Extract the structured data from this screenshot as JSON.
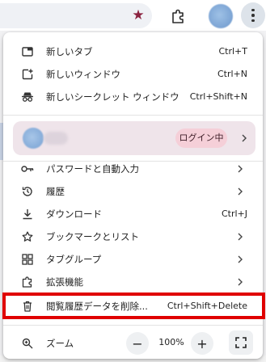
{
  "menu": {
    "items": [
      {
        "icon": "new-tab-icon",
        "label": "新しいタブ",
        "shortcut": "Ctrl+T"
      },
      {
        "icon": "new-window-icon",
        "label": "新しいウィンドウ",
        "shortcut": "Ctrl+N"
      },
      {
        "icon": "incognito-icon",
        "label": "新しいシークレット ウィンドウ",
        "shortcut": "Ctrl+Shift+N"
      }
    ],
    "profile": {
      "status": "ログイン中"
    },
    "items2": [
      {
        "icon": "key-icon",
        "label": "パスワードと自動入力"
      },
      {
        "icon": "history-icon",
        "label": "履歴"
      },
      {
        "icon": "download-icon",
        "label": "ダウンロード",
        "shortcut": "Ctrl+J"
      },
      {
        "icon": "bookmark-star-icon",
        "label": "ブックマークとリスト"
      },
      {
        "icon": "tab-groups-icon",
        "label": "タブグループ"
      },
      {
        "icon": "extensions-icon",
        "label": "拡張機能"
      },
      {
        "icon": "trash-icon",
        "label": "閲覧履歴データを削除...",
        "shortcut": "Ctrl+Shift+Delete"
      }
    ],
    "zoom": {
      "label": "ズーム",
      "minus": "−",
      "value": "100%",
      "plus": "+"
    }
  },
  "colors": {
    "highlight": "#e00000",
    "star": "#8b2340",
    "login_pill": "#f5cfd8",
    "profile_row": "#efe4ea"
  }
}
